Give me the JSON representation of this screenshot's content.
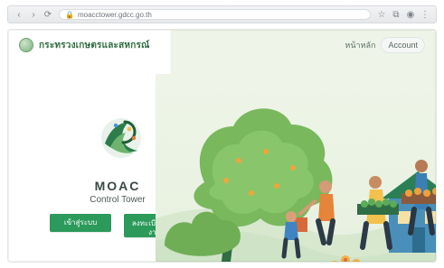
{
  "browser": {
    "address_text": "moacctower.gdcc.go.th",
    "right_icons": [
      "star-icon",
      "extensions-icon",
      "profile-icon",
      "menu-icon"
    ]
  },
  "header": {
    "org_name": "กระทรวงเกษตรและสหกรณ์",
    "login_text": "หน้าหลัก",
    "login_pill": "Account"
  },
  "hero": {
    "title": "MOAC",
    "subtitle": "Control Tower",
    "buttons": [
      {
        "label": "เข้าสู่ระบบ"
      },
      {
        "label": "ลงทะเบียนผู้ใช้งาน"
      }
    ]
  },
  "colors": {
    "accent": "#2b9a5a",
    "accent_dark": "#1f7f49",
    "background_right": "#eef5e8"
  }
}
